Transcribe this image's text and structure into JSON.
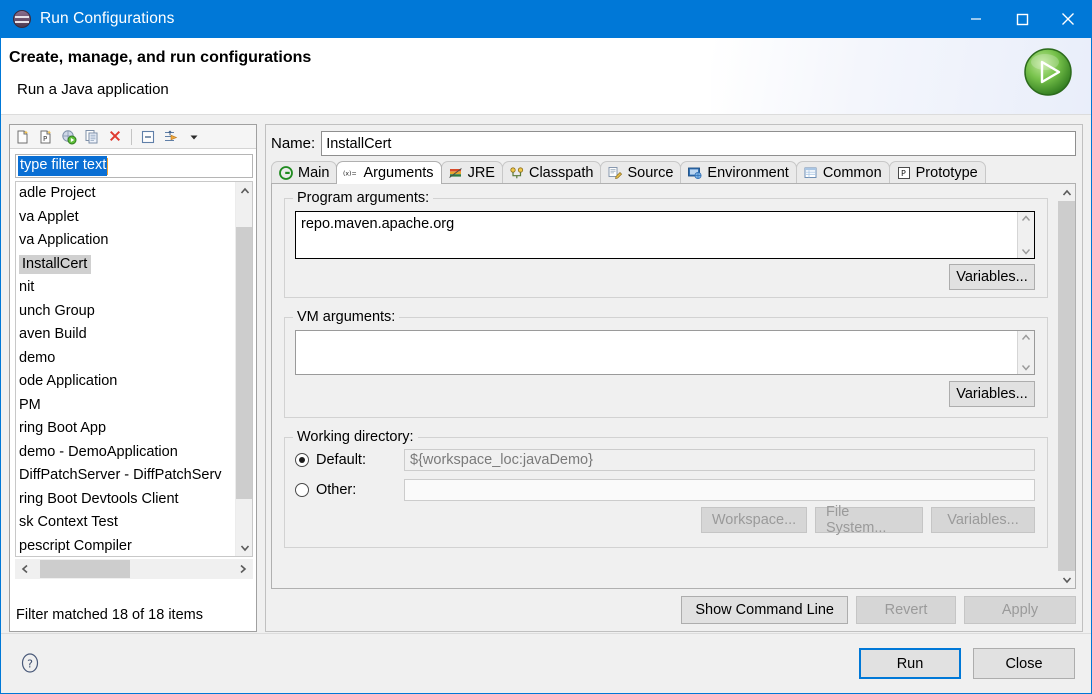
{
  "window": {
    "title": "Run Configurations",
    "icon": "eclipse-run-config-icon",
    "minimize_label": "Minimize",
    "maximize_label": "Maximize",
    "close_label": "Close"
  },
  "header": {
    "title": "Create, manage, and run configurations",
    "subtitle": "Run a Java application",
    "logo": "green-run-play-icon"
  },
  "sidebar": {
    "toolbar": [
      {
        "name": "new-configuration-icon",
        "title": "New launch configuration"
      },
      {
        "name": "new-prototype-icon",
        "title": "New prototype"
      },
      {
        "name": "export-configuration-icon",
        "title": "Export launch configuration"
      },
      {
        "name": "duplicate-configuration-icon",
        "title": "Duplicate currently selected launch configuration"
      },
      {
        "name": "delete-configuration-icon",
        "title": "Delete selected launch configuration(s)"
      },
      {
        "name": "collapse-all-icon",
        "title": "Collapse All"
      },
      {
        "name": "filter-icon",
        "title": "Filter launch configurations"
      },
      {
        "name": "chevron-down-icon",
        "title": "View Menu"
      }
    ],
    "filter": {
      "value": "type filter text",
      "placeholder": "type filter text",
      "selected": true
    },
    "tree_items": [
      {
        "label": "adle Project",
        "selected": false
      },
      {
        "label": "va Applet",
        "selected": false
      },
      {
        "label": "va Application",
        "selected": false
      },
      {
        "label": "InstallCert",
        "selected": true
      },
      {
        "label": "nit",
        "selected": false
      },
      {
        "label": "unch Group",
        "selected": false
      },
      {
        "label": "aven Build",
        "selected": false
      },
      {
        "label": "demo",
        "selected": false
      },
      {
        "label": "ode Application",
        "selected": false
      },
      {
        "label": "PM",
        "selected": false
      },
      {
        "label": "ring Boot App",
        "selected": false
      },
      {
        "label": "demo - DemoApplication",
        "selected": false
      },
      {
        "label": "DiffPatchServer - DiffPatchServ",
        "selected": false
      },
      {
        "label": "ring Boot Devtools Client",
        "selected": false
      },
      {
        "label": "sk Context Test",
        "selected": false
      },
      {
        "label": "pescript Compiler",
        "selected": false
      }
    ],
    "status": "Filter matched 18 of 18 items"
  },
  "main": {
    "name_label": "Name:",
    "name_value": "InstallCert",
    "tabs": [
      {
        "label": "Main",
        "icon": "main-tab-icon",
        "active": false
      },
      {
        "label": "Arguments",
        "icon": "arguments-tab-icon",
        "active": true
      },
      {
        "label": "JRE",
        "icon": "jre-tab-icon",
        "active": false
      },
      {
        "label": "Classpath",
        "icon": "classpath-tab-icon",
        "active": false
      },
      {
        "label": "Source",
        "icon": "source-tab-icon",
        "active": false
      },
      {
        "label": "Environment",
        "icon": "environment-tab-icon",
        "active": false
      },
      {
        "label": "Common",
        "icon": "common-tab-icon",
        "active": false
      },
      {
        "label": "Prototype",
        "icon": "prototype-tab-icon",
        "active": false
      }
    ],
    "program_arguments": {
      "legend": "Program arguments:",
      "value": "repo.maven.apache.org",
      "variables_button": "Variables..."
    },
    "vm_arguments": {
      "legend": "VM arguments:",
      "value": "",
      "variables_button": "Variables..."
    },
    "working_directory": {
      "legend": "Working directory:",
      "default_label": "Default:",
      "default_value": "${workspace_loc:javaDemo}",
      "default_selected": true,
      "other_label": "Other:",
      "other_value": "",
      "other_selected": false,
      "workspace_button": "Workspace...",
      "file_system_button": "File System...",
      "variables_button": "Variables..."
    },
    "panel_buttons": {
      "show_command_line": "Show Command Line",
      "revert": "Revert",
      "apply": "Apply"
    }
  },
  "footer": {
    "help_icon": "help-question-icon",
    "run_button": "Run",
    "close_button": "Close"
  },
  "colors": {
    "titlebar": "#0078d7",
    "accent": "#0078d7",
    "selection": "#0a6fd4",
    "tree_selection": "#d0d0d0",
    "dialog_bg": "#f0f0f0"
  }
}
